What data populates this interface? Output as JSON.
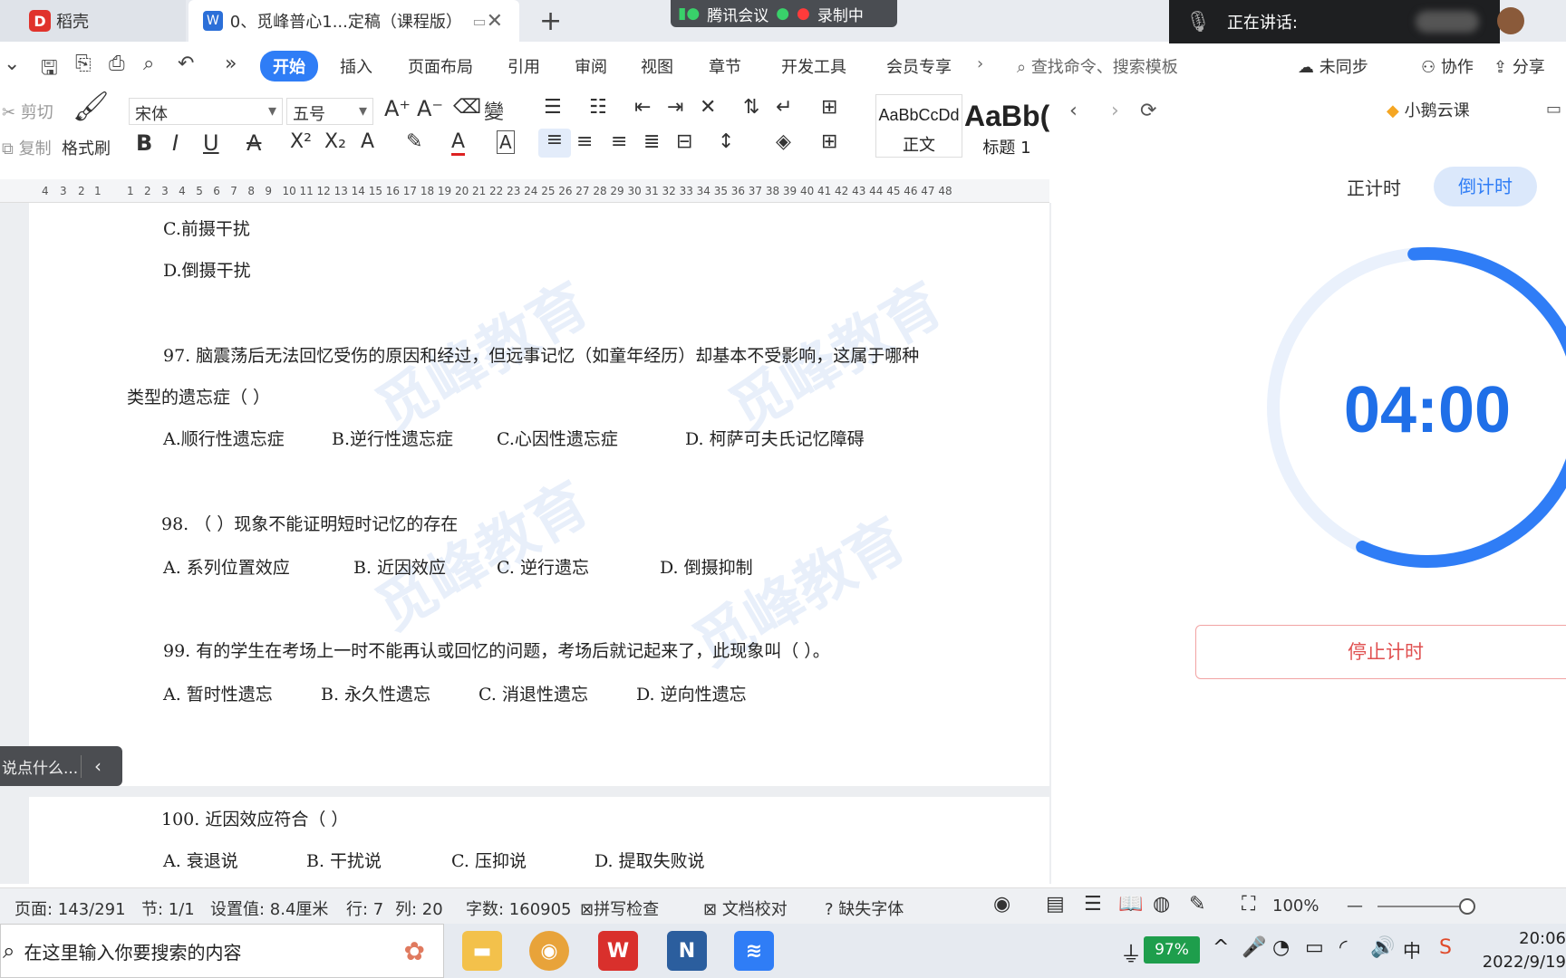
{
  "titlebar": {
    "tabs": [
      {
        "label": "稻壳"
      },
      {
        "label": "0、觅峰普心1...定稿（课程版）"
      }
    ],
    "new_tab": "+",
    "close": "✕",
    "meeting": {
      "app": "腾讯会议",
      "recording": "录制中"
    },
    "speaking_label": "正在讲话:"
  },
  "ribbon": {
    "menus": [
      "开始",
      "插入",
      "页面布局",
      "引用",
      "审阅",
      "视图",
      "章节",
      "开发工具",
      "会员专享"
    ],
    "search_placeholder": "查找命令、搜索模板",
    "right": [
      "未同步",
      "协作",
      "分享"
    ]
  },
  "toolbar": {
    "cut": "剪切",
    "copy": "复制",
    "format_painter": "格式刷",
    "font_name": "宋体",
    "font_size": "五号",
    "styles": [
      {
        "sample": "AaBbCcDd",
        "label": "正文"
      },
      {
        "sample": "AaBb(",
        "label": "标题 1"
      }
    ]
  },
  "ruler": [
    "4",
    "3",
    "2",
    "1",
    "1",
    "2",
    "3",
    "4",
    "5",
    "6",
    "7",
    "8",
    "9",
    "10",
    "11",
    "12",
    "13",
    "14",
    "15",
    "16",
    "17",
    "18",
    "19",
    "20",
    "21",
    "22",
    "23",
    "24",
    "25",
    "26",
    "27",
    "28",
    "29",
    "30",
    "31",
    "32",
    "33",
    "34",
    "35",
    "36",
    "37",
    "38",
    "39",
    "40",
    "41",
    "42",
    "43",
    "44",
    "45",
    "46",
    "47",
    "48"
  ],
  "document": {
    "lines": [
      "C.前摄干扰",
      "D.倒摄干扰",
      "97. 脑震荡后无法回忆受伤的原因和经过，但远事记忆（如童年经历）却基本不受影响，这属于哪种",
      "类型的遗忘症（     ）",
      "98. （   ）现象不能证明短时记忆的存在",
      "99. 有的学生在考场上一时不能再认或回忆的问题，考场后就记起来了，此现象叫（    ）。",
      "100. 近因效应符合（     ）"
    ],
    "q97_options": [
      "A.顺行性遗忘症",
      "B.逆行性遗忘症",
      "C.心因性遗忘症",
      "D. 柯萨可夫氏记忆障碍"
    ],
    "q98_options": [
      "A. 系列位置效应",
      "B. 近因效应",
      "C. 逆行遗忘",
      "D. 倒摄抑制"
    ],
    "q99_options": [
      "A. 暂时性遗忘",
      "B. 永久性遗忘",
      "C. 消退性遗忘",
      "D. 逆向性遗忘"
    ],
    "q100_options": [
      "A. 衰退说",
      "B. 干扰说",
      "C. 压抑说",
      "D. 提取失败说"
    ],
    "comment_tab": "说点什么..."
  },
  "statusbar": {
    "page": "页面: 143/291",
    "section": "节: 1/1",
    "setting": "设置值: 8.4厘米",
    "row": "行: 7",
    "col": "列: 20",
    "words": "字数: 160905",
    "spell": "拼写检查",
    "proof": "文档校对",
    "missing_font": "缺失字体",
    "zoom": "100%"
  },
  "timer": {
    "brand": "小鹅云课",
    "mode_up": "正计时",
    "mode_down": "倒计时",
    "value": "04:00",
    "stop": "停止计时",
    "accent": "#2f7df6"
  },
  "taskbar": {
    "search_placeholder": "在这里输入你要搜索的内容",
    "battery": "97%",
    "ime": "中",
    "time": "20:06",
    "date": "2022/9/19"
  }
}
